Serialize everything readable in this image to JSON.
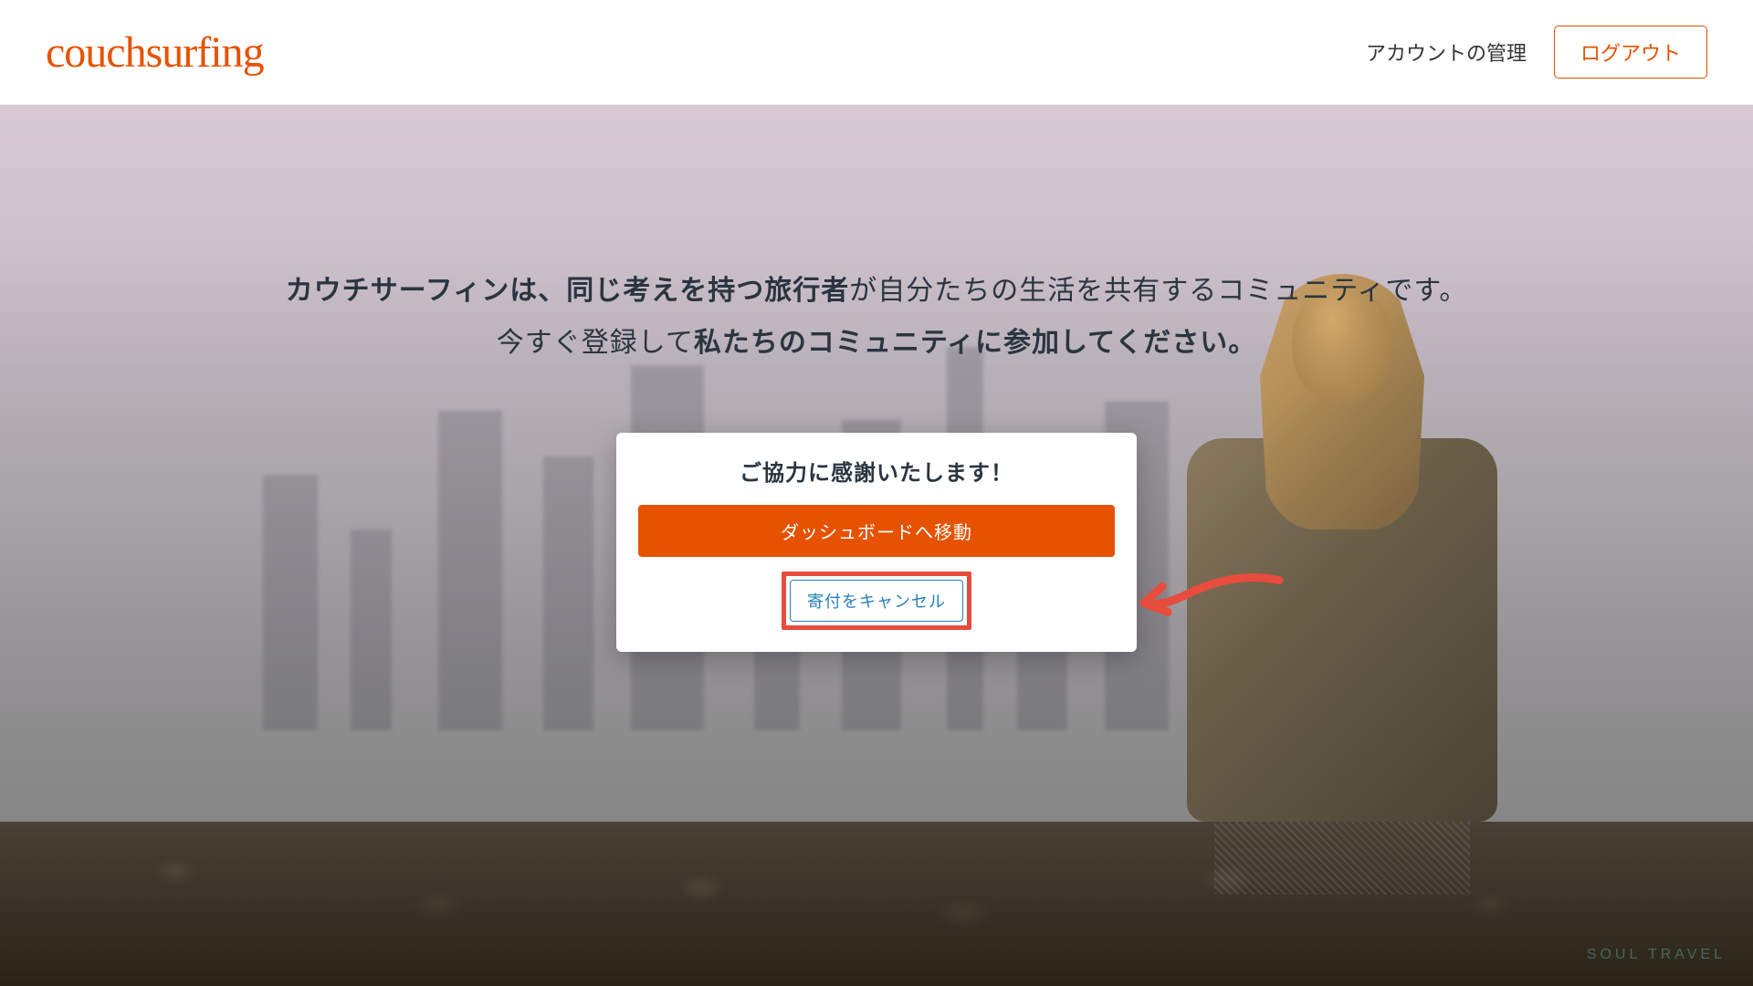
{
  "header": {
    "logo_text": "couchsurfing",
    "account_link": "アカウントの管理",
    "logout_button": "ログアウト"
  },
  "hero": {
    "line1_bold": "カウチサーフィンは、同じ考えを持つ旅行者",
    "line1_rest": "が自分たちの生活を共有するコミュニティです。",
    "line2_pre": "今すぐ登録して",
    "line2_bold": "私たちのコミュニティに参加してください。"
  },
  "modal": {
    "title": "ご協力に感謝いたします！",
    "primary_button": "ダッシュボードへ移動",
    "secondary_button": "寄付をキャンセル"
  },
  "watermark": "SOUL TRAVEL",
  "colors": {
    "brand_orange": "#e65200",
    "annotation_red": "#e74c3c",
    "link_blue": "#2980b9"
  }
}
